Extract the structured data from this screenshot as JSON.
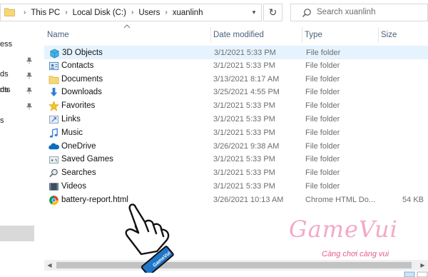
{
  "address": {
    "crumbs": [
      "This PC",
      "Local Disk (C:)",
      "Users",
      "xuanlinh"
    ]
  },
  "search": {
    "placeholder": "Search xuanlinh"
  },
  "nav": {
    "items": [
      {
        "label": "ess",
        "pinned": false
      },
      {
        "label": "ds",
        "pinned": true
      },
      {
        "label": "ds",
        "pinned": true
      },
      {
        "label": "nts",
        "pinned": true
      },
      {
        "label": "",
        "pinned": true
      },
      {
        "label": "s",
        "pinned": false
      }
    ]
  },
  "columns": {
    "name": "Name",
    "date": "Date modified",
    "type": "Type",
    "size": "Size"
  },
  "files": [
    {
      "name": "3D Objects",
      "date": "3/1/2021 5:33 PM",
      "type": "File folder",
      "size": "",
      "icon": "3d-objects-icon"
    },
    {
      "name": "Contacts",
      "date": "3/1/2021 5:33 PM",
      "type": "File folder",
      "size": "",
      "icon": "contacts-icon"
    },
    {
      "name": "Documents",
      "date": "3/13/2021 8:17 AM",
      "type": "File folder",
      "size": "",
      "icon": "documents-icon"
    },
    {
      "name": "Downloads",
      "date": "3/25/2021 4:55 PM",
      "type": "File folder",
      "size": "",
      "icon": "downloads-icon"
    },
    {
      "name": "Favorites",
      "date": "3/1/2021 5:33 PM",
      "type": "File folder",
      "size": "",
      "icon": "favorites-icon"
    },
    {
      "name": "Links",
      "date": "3/1/2021 5:33 PM",
      "type": "File folder",
      "size": "",
      "icon": "links-icon"
    },
    {
      "name": "Music",
      "date": "3/1/2021 5:33 PM",
      "type": "File folder",
      "size": "",
      "icon": "music-icon"
    },
    {
      "name": "OneDrive",
      "date": "3/26/2021 9:38 AM",
      "type": "File folder",
      "size": "",
      "icon": "onedrive-icon"
    },
    {
      "name": "Saved Games",
      "date": "3/1/2021 5:33 PM",
      "type": "File folder",
      "size": "",
      "icon": "saved-games-icon"
    },
    {
      "name": "Searches",
      "date": "3/1/2021 5:33 PM",
      "type": "File folder",
      "size": "",
      "icon": "searches-icon"
    },
    {
      "name": "Videos",
      "date": "3/1/2021 5:33 PM",
      "type": "File folder",
      "size": "",
      "icon": "videos-icon"
    },
    {
      "name": "battery-report.html",
      "date": "3/26/2021 10:13 AM",
      "type": "Chrome HTML Do...",
      "size": "54 KB",
      "icon": "chrome-html-icon"
    }
  ],
  "selected_file": "3D Objects",
  "watermark": {
    "logo": "GameVui",
    "tagline": "Càng chơi càng vui",
    "hand_label": "GameVui"
  },
  "colors": {
    "accent": "#0078d7",
    "selection": "#e5f3ff",
    "header_text": "#4c607a",
    "folder": "#f8d775"
  }
}
